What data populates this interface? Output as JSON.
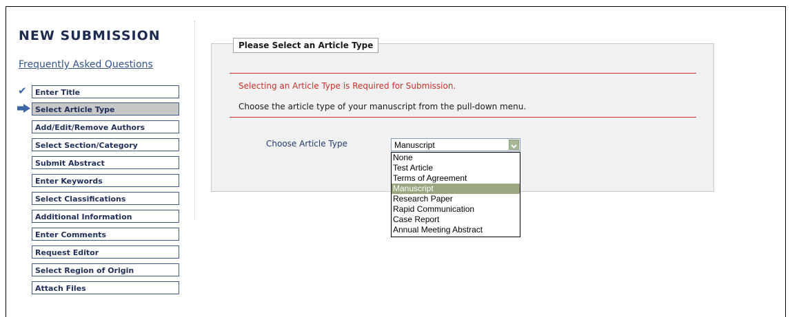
{
  "page": {
    "title": "NEW SUBMISSION",
    "faq_link": "Frequently Asked Questions"
  },
  "nav": {
    "items": [
      {
        "label": "Enter Title",
        "state": "completed"
      },
      {
        "label": "Select Article Type",
        "state": "current"
      },
      {
        "label": "Add/Edit/Remove Authors",
        "state": "pending"
      },
      {
        "label": "Select Section/Category",
        "state": "pending"
      },
      {
        "label": "Submit Abstract",
        "state": "pending"
      },
      {
        "label": "Enter Keywords",
        "state": "pending"
      },
      {
        "label": "Select Classifications",
        "state": "pending"
      },
      {
        "label": "Additional Information",
        "state": "pending"
      },
      {
        "label": "Enter Comments",
        "state": "pending"
      },
      {
        "label": "Request Editor",
        "state": "pending"
      },
      {
        "label": "Select Region of Origin",
        "state": "pending"
      },
      {
        "label": "Attach Files",
        "state": "pending"
      }
    ],
    "completed_icon": "checkmark-icon",
    "current_icon": "arrow-right-icon"
  },
  "panel": {
    "legend": "Please Select an Article Type",
    "required_message": "Selecting an Article Type is Required for Submission.",
    "instruction": "Choose the article type of your manuscript from the pull-down menu.",
    "choose_label": "Choose Article Type",
    "select": {
      "value": "Manuscript",
      "options": [
        "None",
        "Test Article",
        "Terms of Agreement",
        "Manuscript",
        "Research Paper",
        "Rapid Communication",
        "Case Report",
        "Annual Meeting Abstract"
      ],
      "highlighted_index": 3
    }
  },
  "colors": {
    "title": "#1c2b4f",
    "link": "#33538a",
    "error": "#c8322b",
    "nav_border": "#3d5b8c",
    "nav_active_bg": "#c8c8c8",
    "dropdown_highlight": "#9aa781"
  }
}
